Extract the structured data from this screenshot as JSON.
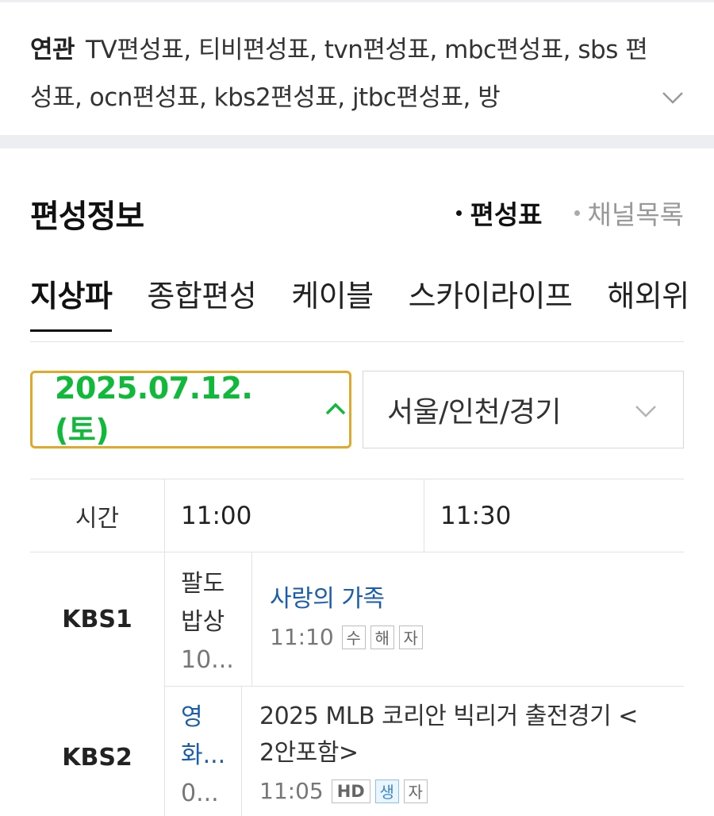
{
  "related": {
    "label": "연관",
    "terms": "TV편성표, 티비편성표, tvn편성표, mbc편성표, sbs 편성표, ocn편성표, kbs2편성표, jtbc편성표, 방"
  },
  "section": {
    "title": "편성정보",
    "views": [
      {
        "label": "편성표",
        "active": true
      },
      {
        "label": "채널목록",
        "active": false
      }
    ]
  },
  "categories": [
    "지상파",
    "종합편성",
    "케이블",
    "스카이라이프",
    "해외위"
  ],
  "filters": {
    "date": "2025.07.12.(토)",
    "region": "서울/인천/경기"
  },
  "grid": {
    "time_label": "시간",
    "slots": [
      "11:00",
      "11:30"
    ],
    "channels": [
      {
        "name": "KBS1",
        "prev_program": {
          "line1": "팔도",
          "line2": "밥상",
          "line3": "10..."
        },
        "program": {
          "title": "사랑의 가족",
          "time": "11:10",
          "badges": [
            "수",
            "해",
            "자"
          ]
        }
      },
      {
        "name": "KBS2",
        "prev_program": {
          "line1": "영",
          "line2": "화...",
          "line3": "0..."
        },
        "program": {
          "title_line1": "2025 MLB 코리안 빅리거 출전경기 <",
          "title_line2": "2안포함>",
          "time": "11:05",
          "badges": [
            "HD",
            "생",
            "자"
          ]
        }
      }
    ]
  },
  "colors": {
    "accent_green": "#10b93a",
    "select_border": "#e2a82a",
    "link_blue": "#1a5cae"
  }
}
